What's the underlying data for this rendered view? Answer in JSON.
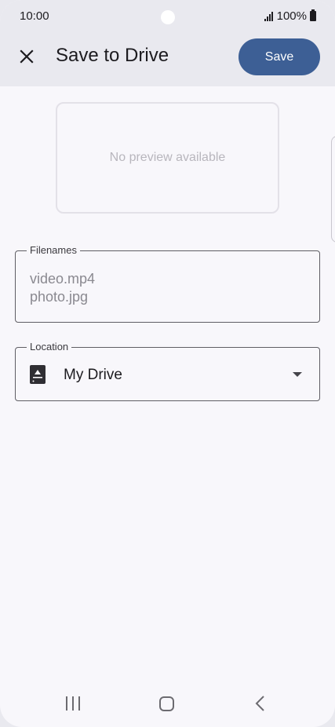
{
  "status_bar": {
    "time": "10:00",
    "battery_text": "100%"
  },
  "app_bar": {
    "title": "Save to Drive",
    "save_label": "Save",
    "close_icon": "close-icon"
  },
  "preview": {
    "text": "No preview available"
  },
  "filenames": {
    "label": "Filenames",
    "values": [
      "video.mp4",
      "photo.jpg"
    ]
  },
  "location": {
    "label": "Location",
    "value": "My Drive",
    "icon": "drive-icon"
  },
  "nav": {
    "recents_icon": "recents-icon",
    "home_icon": "home-icon",
    "back_icon": "back-icon"
  },
  "colors": {
    "accent": "#3d5f95",
    "surface": "#f8f7fb",
    "app_bar": "#e9e9ef"
  }
}
